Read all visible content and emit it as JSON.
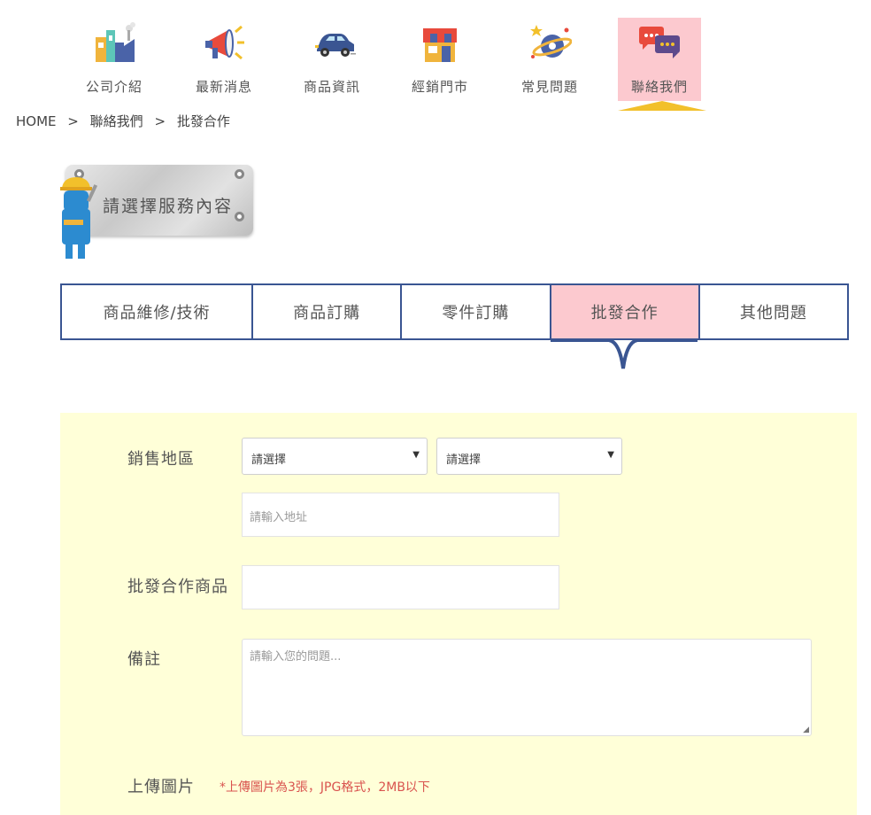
{
  "nav": {
    "items": [
      {
        "label": "公司介紹",
        "icon": "factory-icon"
      },
      {
        "label": "最新消息",
        "icon": "megaphone-icon"
      },
      {
        "label": "商品資訊",
        "icon": "car-icon"
      },
      {
        "label": "經銷門市",
        "icon": "store-icon"
      },
      {
        "label": "常見問題",
        "icon": "planet-icon"
      },
      {
        "label": "聯絡我們",
        "icon": "chat-bubbles-icon",
        "active": true
      }
    ]
  },
  "breadcrumb": {
    "home": "HOME",
    "separator": ">",
    "level1": "聯絡我們",
    "level2": "批發合作"
  },
  "service_plate": {
    "text": "請選擇服務內容"
  },
  "tabs": [
    {
      "label": "商品維修/技術"
    },
    {
      "label": "商品訂購"
    },
    {
      "label": "零件訂購"
    },
    {
      "label": "批發合作",
      "active": true
    },
    {
      "label": "其他問題"
    }
  ],
  "form": {
    "region_label": "銷售地區",
    "city_select": {
      "value": "請選擇"
    },
    "district_select": {
      "value": "請選擇"
    },
    "address_placeholder": "請輸入地址",
    "product_label": "批發合作商品",
    "product_value": "",
    "notes_label": "備註",
    "notes_placeholder": "請輸入您的問題...",
    "upload_label": "上傳圖片",
    "upload_note": "*上傳圖片為3張，JPG格式，2MB以下"
  },
  "colors": {
    "active_bg": "#fcc9cf",
    "tab_border": "#3a5592",
    "form_bg": "#ffffd8",
    "nav_arrow": "#f2c02b",
    "note_red": "#d9534f"
  }
}
